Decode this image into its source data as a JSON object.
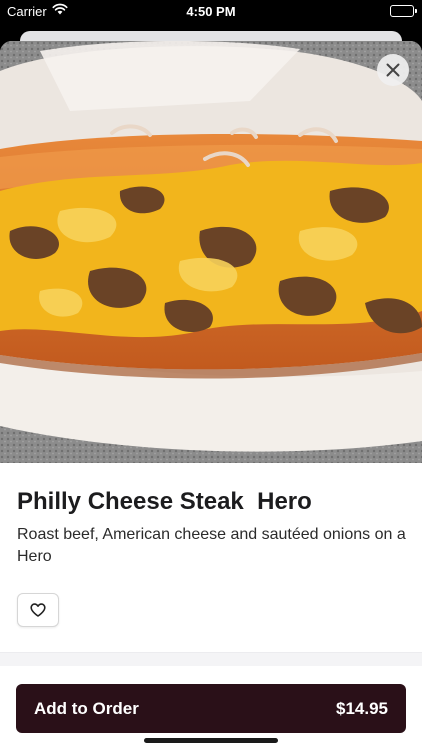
{
  "status_bar": {
    "carrier": "Carrier",
    "time": "4:50 PM"
  },
  "item": {
    "name": "Philly Cheese Steak  Hero",
    "description": "Roast beef, American cheese and sautéed onions on a Hero",
    "image_icon": "food-photo"
  },
  "actions": {
    "close_icon": "close-icon",
    "favorite_icon": "heart-outline-icon",
    "add_to_order_label": "Add to Order",
    "price": "$14.95"
  },
  "colors": {
    "primary_button": "#2a1018",
    "sheet_background": "#ffffff",
    "text_primary": "#1c1c1e"
  }
}
